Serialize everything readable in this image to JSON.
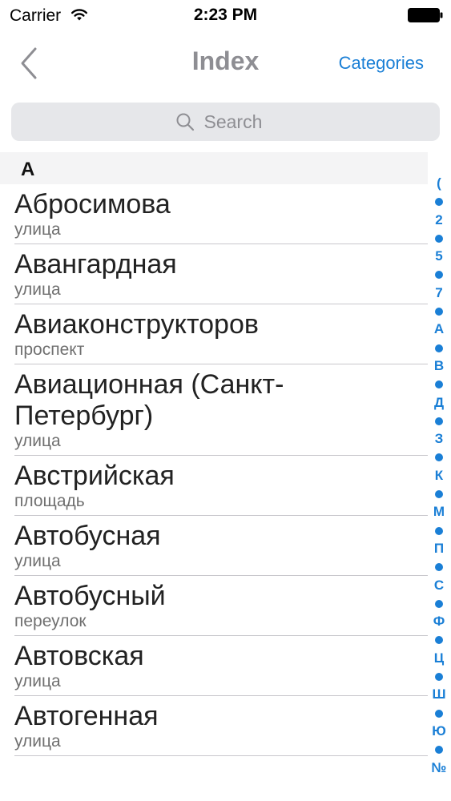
{
  "status_bar": {
    "carrier": "Carrier",
    "time": "2:23 PM"
  },
  "nav": {
    "title": "Index",
    "right_label": "Categories",
    "back_icon": "chevron-left-icon"
  },
  "search": {
    "placeholder": "Search",
    "icon": "search-icon"
  },
  "section": {
    "header": "А"
  },
  "items": [
    {
      "title": "Абросимова",
      "subtitle": "улица"
    },
    {
      "title": "Авангардная",
      "subtitle": "улица"
    },
    {
      "title": "Авиаконструкторов",
      "subtitle": "проспект"
    },
    {
      "title": "Авиационная  (Санкт-Петербург)",
      "subtitle": "улица"
    },
    {
      "title": "Австрийская",
      "subtitle": "площадь"
    },
    {
      "title": "Автобусная",
      "subtitle": "улица"
    },
    {
      "title": "Автобусный",
      "subtitle": "переулок"
    },
    {
      "title": "Автовская",
      "subtitle": "улица"
    },
    {
      "title": "Автогенная",
      "subtitle": "улица"
    }
  ],
  "index_bar": [
    "(",
    "•",
    "2",
    "•",
    "5",
    "•",
    "7",
    "•",
    "А",
    "•",
    "В",
    "•",
    "Д",
    "•",
    "З",
    "•",
    "К",
    "•",
    "М",
    "•",
    "П",
    "•",
    "С",
    "•",
    "Ф",
    "•",
    "Ц",
    "•",
    "Ш",
    "•",
    "Ю",
    "•",
    "№"
  ],
  "colors": {
    "accent": "#1a7fd6",
    "title_gray": "#8e8e93",
    "search_bg": "#e6e7ea",
    "section_bg": "#f4f4f5"
  }
}
